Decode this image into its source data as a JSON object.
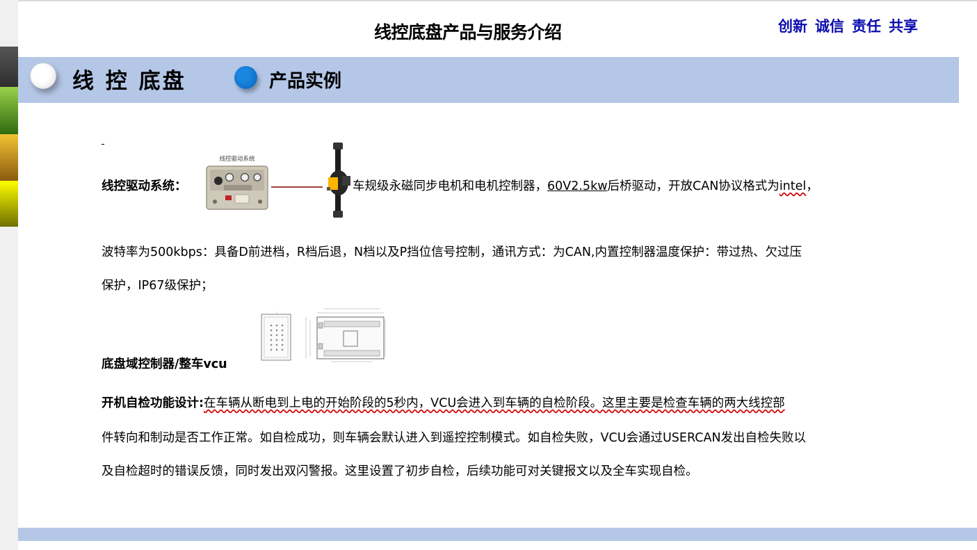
{
  "header": {
    "title": "线控底盘产品与服务介绍",
    "motto": [
      "创新",
      "诚信",
      "责任",
      "共享"
    ]
  },
  "banner": {
    "title": "线 控 底盘",
    "subtitle": "产品实例"
  },
  "section_drive": {
    "label": "线控驱动系统：",
    "image_caption": "线控驱动系统",
    "line1_prefix": "车规级永磁同步电机和电机控制器，",
    "line1_spec": "60V2.5kw",
    "line1_middle": "后桥驱动，开放CAN协议格式为",
    "line1_intel": "intel",
    "line1_end": "，",
    "line2": "波特率为500kbps：具备D前进档，R档后退，N档以及P挡位信号控制，通讯方式：为CAN,内置控制器温度保护：带过热、欠过压",
    "line3": "保护，IP67级保护；"
  },
  "section_vcu": {
    "label": "底盘域控制器/整车vcu"
  },
  "section_selfcheck": {
    "label": "开机自检功能设计:",
    "line1": "在车辆从断电到上电的开始阶段的5秒内，VCU会进入到车辆的自检阶段。这里主要是检查车辆的两大线控部",
    "line2": "件转向和制动是否工作正常。如自检成功，则车辆会默认进入到遥控控制模式。如自检失败，VCU会通过USERCAN发出自检失败以",
    "line3": "及自检超时的错误反馈，同时发出双闪警报。这里设置了初步自检，后续功能可对关键报文以及全车实现自检。"
  },
  "colors": {
    "banner": "#b4c7e7",
    "motto": "#0b0bb0",
    "accent_circle": "#0a6fd0"
  }
}
